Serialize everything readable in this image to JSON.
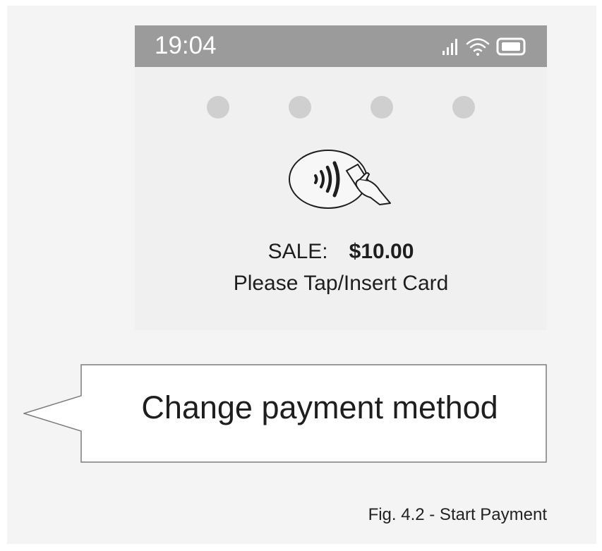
{
  "status_bar": {
    "time": "19:04",
    "icons": [
      "signal-icon",
      "wifi-icon",
      "battery-icon"
    ]
  },
  "pin_entry": {
    "dot_count": 4
  },
  "payment": {
    "icon": "contactless-card-icon",
    "sale_label": "SALE:",
    "amount": "$10.00",
    "prompt": "Please Tap/Insert Card"
  },
  "callout": {
    "text": "Change payment method"
  },
  "caption": "Fig. 4.2 - Start Payment",
  "colors": {
    "status_bar": "#9b9b9b",
    "screen": "#f0f0f0",
    "dot": "#cfcfcf",
    "text": "#1e1e1e"
  }
}
